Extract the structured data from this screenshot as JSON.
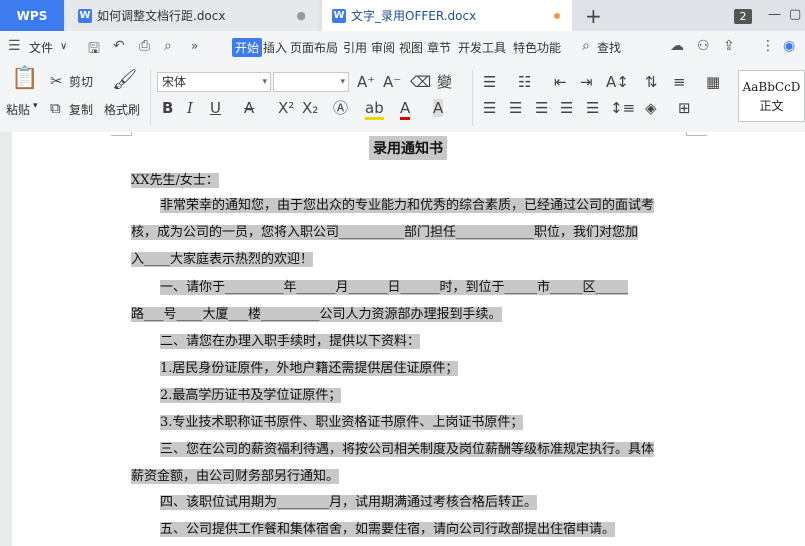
{
  "tabs": {
    "app": "WPS",
    "doc1": "如何调整文档行距.docx",
    "doc2": "文字_录用OFFER.docx",
    "add": "+",
    "badge": "2"
  },
  "menu": {
    "file": "文件",
    "tabs": [
      "开始",
      "插入",
      "页面布局",
      "引用",
      "审阅",
      "视图",
      "章节",
      "开发工具",
      "特色功能"
    ],
    "search": "查找"
  },
  "ribbon": {
    "paste": "粘贴",
    "cut": "剪切",
    "copy": "复制",
    "format_painter": "格式刷",
    "font_name": "宋体",
    "font_size": "",
    "style_sample": "AaBbCcD",
    "style_name": "正文"
  },
  "document": {
    "title": "录用通知书",
    "lines": [
      "XX先生/女士：",
      "非常荣幸的通知您，由于您出众的专业能力和优秀的综合素质，已经通过公司的面试考",
      "核，成为公司的一员，您将入职公司__________部门担任____________职位，我们对您加",
      "入____大家庭表示热烈的欢迎！",
      "一、请你于_________年______月______日______时，到位于_____市_____区_____",
      "路___号____大厦___楼_________公司人力资源部办理报到手续。",
      "二、请您在办理入职手续时，提供以下资料：",
      "1.居民身份证原件，外地户籍还需提供居住证原件；",
      "2.最高学历证书及学位证原件；",
      "3.专业技术职称证书原件、职业资格证书原件、上岗证书原件；",
      "三、您在公司的薪资福利待遇，将按公司相关制度及岗位薪酬等级标准规定执行。具体",
      "薪资金额，由公司财务部另行通知。",
      "四、该职位试用期为________月，试用期满通过考核合格后转正。",
      "五、公司提供工作餐和集体宿舍，如需要住宿，请向公司行政部提出住宿申请。"
    ]
  }
}
